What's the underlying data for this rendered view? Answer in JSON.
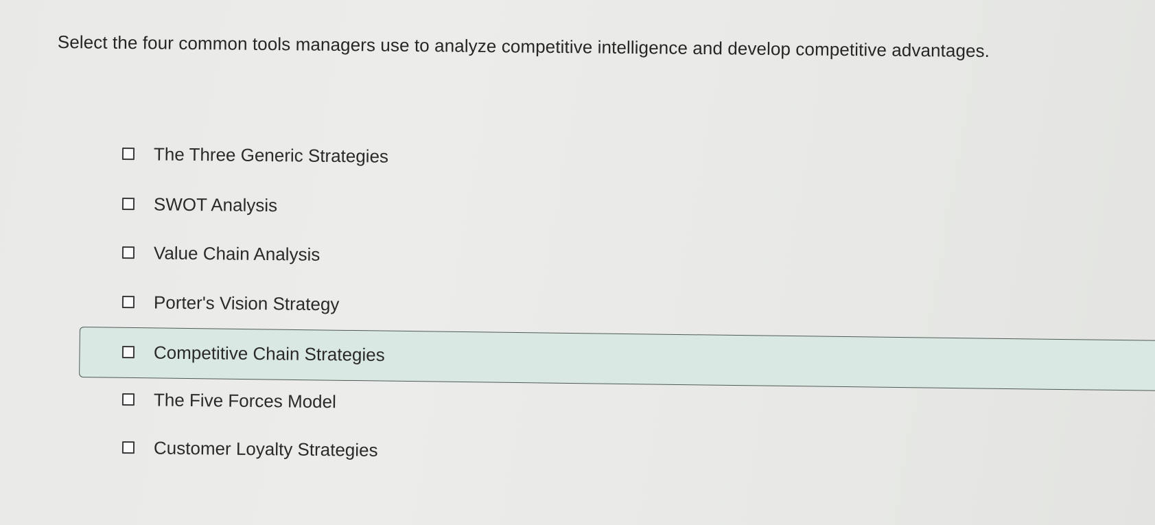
{
  "question": {
    "text": "Select the four common tools managers use to analyze competitive intelligence and develop competitive advantages."
  },
  "options": [
    {
      "label": "The Three Generic Strategies",
      "checked": false
    },
    {
      "label": "SWOT Analysis",
      "checked": false
    },
    {
      "label": "Value Chain Analysis",
      "checked": false
    },
    {
      "label": "Porter's Vision Strategy",
      "checked": false
    },
    {
      "label": "Competitive Chain Strategies",
      "checked": false,
      "highlighted": true
    },
    {
      "label": "The Five Forces Model",
      "checked": false
    },
    {
      "label": "Customer Loyalty Strategies",
      "checked": false
    }
  ],
  "colors": {
    "highlight": "#d9e8e2",
    "background": "#eaeae8"
  }
}
